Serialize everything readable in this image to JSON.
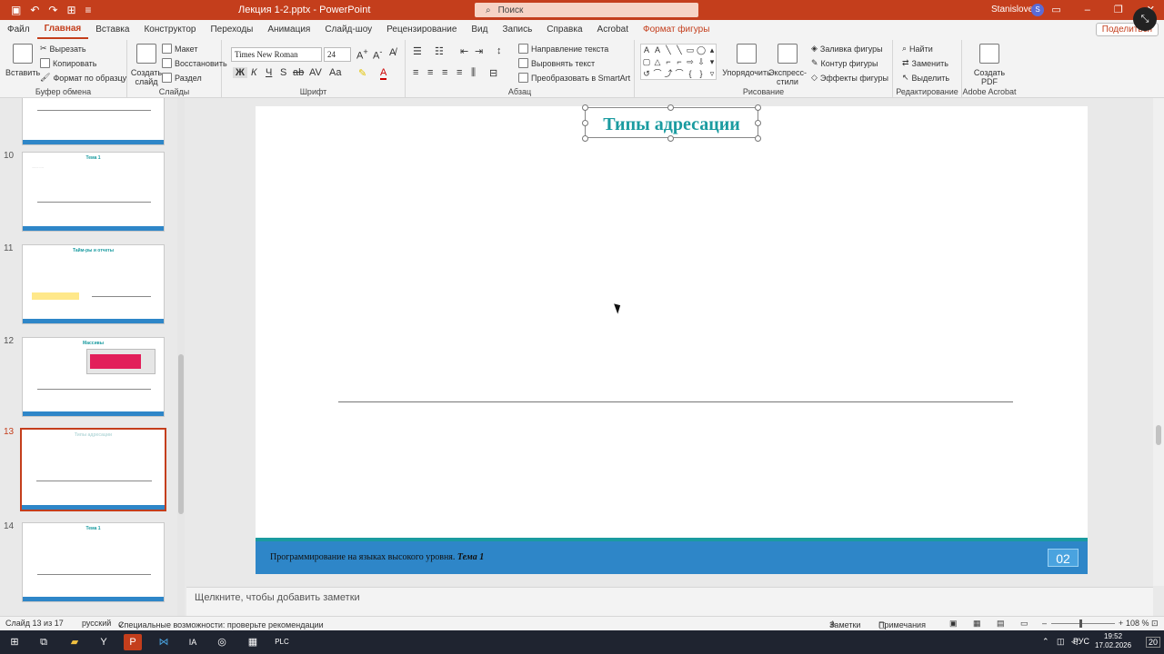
{
  "titlebar": {
    "title": "Лекция 1-2.pptx  -  PowerPoint",
    "search_placeholder": "Поиск",
    "user": "Stanislove",
    "avatar": "S",
    "icons": [
      "save-icon",
      "undo-icon",
      "redo-icon",
      "present-icon",
      "customize-icon"
    ]
  },
  "tabs": {
    "items": [
      "Файл",
      "Главная",
      "Вставка",
      "Конструктор",
      "Переходы",
      "Анимация",
      "Слайд-шоу",
      "Рецензирование",
      "Вид",
      "Запись",
      "Справка",
      "Acrobat",
      "Формат фигуры"
    ],
    "active": "Главная",
    "share": "Поделиться"
  },
  "ribbon": {
    "clipboard": {
      "paste": "Вставить",
      "cut": "Вырезать",
      "copy": "Копировать",
      "format_painter": "Формат по образцу",
      "label": "Буфер обмена"
    },
    "slides": {
      "new_slide": "Создать слайд",
      "layout": "Макет",
      "reset": "Восстановить",
      "section": "Раздел",
      "label": "Слайды"
    },
    "font": {
      "name": "Times New Roman",
      "size": "24",
      "bold": "Ж",
      "italic": "К",
      "underline": "Ч",
      "strike": "S",
      "label": "Шрифт"
    },
    "paragraph": {
      "text_direction": "Направление текста",
      "align_text": "Выровнять текст",
      "smartart": "Преобразовать в SmartArt",
      "label": "Абзац"
    },
    "drawing": {
      "arrange": "Упорядочить",
      "quick_styles": "Экспресс-стили",
      "fill": "Заливка фигуры",
      "outline": "Контур фигуры",
      "effects": "Эффекты фигуры",
      "label": "Рисование"
    },
    "editing": {
      "find": "Найти",
      "replace": "Заменить",
      "select": "Выделить",
      "label": "Редактирование"
    },
    "acrobat": {
      "create_pdf": "Создать PDF",
      "label": "Adobe Acrobat"
    }
  },
  "thumbnails": [
    {
      "num": "",
      "title": ""
    },
    {
      "num": "10",
      "title": "Тема 1"
    },
    {
      "num": "11",
      "title": "Тайм-ры и отчеты"
    },
    {
      "num": "12",
      "title": "Массивы"
    },
    {
      "num": "13",
      "title": "Типы адресации"
    },
    {
      "num": "14",
      "title": "Тема 1"
    }
  ],
  "slide": {
    "title": "Типы адресации",
    "footer_text": "Программирование на языках высокого уровня.",
    "footer_topic": "Тема 1",
    "page": "02"
  },
  "notes_placeholder": "Щелкните, чтобы добавить заметки",
  "status": {
    "slide_of": "Слайд 13 из 17",
    "language": "русский",
    "accessibility": "Специальные возможности: проверьте рекомендации",
    "notes": "Заметки",
    "comments": "Примечания",
    "zoom": "108 %"
  },
  "taskbar": {
    "lang": "РУС",
    "time": "19:52",
    "date": "17.02.2026",
    "notif": "20"
  }
}
